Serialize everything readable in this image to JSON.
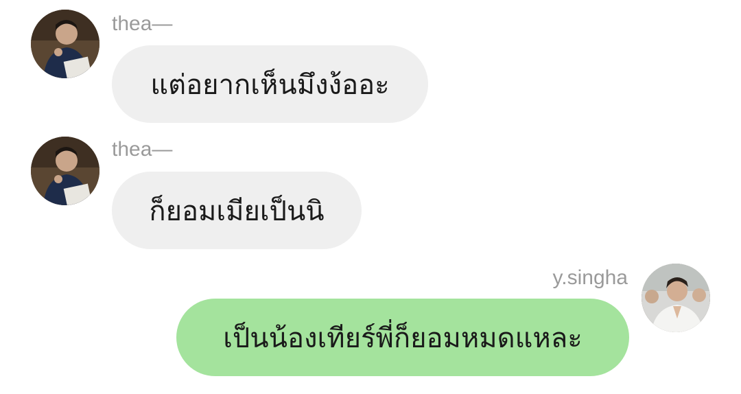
{
  "messages": [
    {
      "sender": "thea—",
      "text": "แต่อยากเห็นมึงง้ออะ",
      "direction": "incoming",
      "avatar": "avatar-thea"
    },
    {
      "sender": "thea—",
      "text": "ก็ยอมเมียเป็นนิ",
      "direction": "incoming",
      "avatar": "avatar-thea"
    },
    {
      "sender": "y.singha",
      "text": "เป็นน้องเทียร์พี่ก็ยอมหมดแหละ",
      "direction": "outgoing",
      "avatar": "avatar-ysingha"
    }
  ],
  "colors": {
    "incoming_bubble": "#efefef",
    "outgoing_bubble": "#a4e39d",
    "sender_name": "#9a9a9a",
    "message_text": "#1a1a1a",
    "background": "#ffffff"
  }
}
